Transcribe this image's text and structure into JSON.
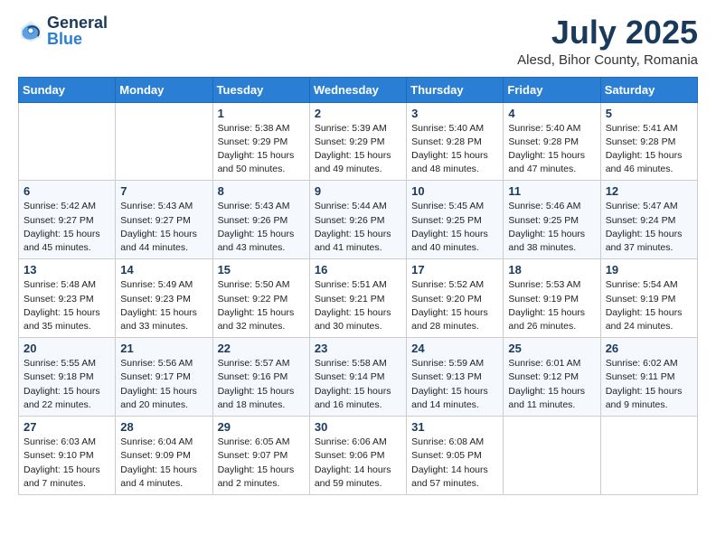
{
  "logo": {
    "general": "General",
    "blue": "Blue"
  },
  "header": {
    "month_year": "July 2025",
    "location": "Alesd, Bihor County, Romania"
  },
  "days_of_week": [
    "Sunday",
    "Monday",
    "Tuesday",
    "Wednesday",
    "Thursday",
    "Friday",
    "Saturday"
  ],
  "weeks": [
    [
      {
        "day": "",
        "info": ""
      },
      {
        "day": "",
        "info": ""
      },
      {
        "day": "1",
        "info": "Sunrise: 5:38 AM\nSunset: 9:29 PM\nDaylight: 15 hours\nand 50 minutes."
      },
      {
        "day": "2",
        "info": "Sunrise: 5:39 AM\nSunset: 9:29 PM\nDaylight: 15 hours\nand 49 minutes."
      },
      {
        "day": "3",
        "info": "Sunrise: 5:40 AM\nSunset: 9:28 PM\nDaylight: 15 hours\nand 48 minutes."
      },
      {
        "day": "4",
        "info": "Sunrise: 5:40 AM\nSunset: 9:28 PM\nDaylight: 15 hours\nand 47 minutes."
      },
      {
        "day": "5",
        "info": "Sunrise: 5:41 AM\nSunset: 9:28 PM\nDaylight: 15 hours\nand 46 minutes."
      }
    ],
    [
      {
        "day": "6",
        "info": "Sunrise: 5:42 AM\nSunset: 9:27 PM\nDaylight: 15 hours\nand 45 minutes."
      },
      {
        "day": "7",
        "info": "Sunrise: 5:43 AM\nSunset: 9:27 PM\nDaylight: 15 hours\nand 44 minutes."
      },
      {
        "day": "8",
        "info": "Sunrise: 5:43 AM\nSunset: 9:26 PM\nDaylight: 15 hours\nand 43 minutes."
      },
      {
        "day": "9",
        "info": "Sunrise: 5:44 AM\nSunset: 9:26 PM\nDaylight: 15 hours\nand 41 minutes."
      },
      {
        "day": "10",
        "info": "Sunrise: 5:45 AM\nSunset: 9:25 PM\nDaylight: 15 hours\nand 40 minutes."
      },
      {
        "day": "11",
        "info": "Sunrise: 5:46 AM\nSunset: 9:25 PM\nDaylight: 15 hours\nand 38 minutes."
      },
      {
        "day": "12",
        "info": "Sunrise: 5:47 AM\nSunset: 9:24 PM\nDaylight: 15 hours\nand 37 minutes."
      }
    ],
    [
      {
        "day": "13",
        "info": "Sunrise: 5:48 AM\nSunset: 9:23 PM\nDaylight: 15 hours\nand 35 minutes."
      },
      {
        "day": "14",
        "info": "Sunrise: 5:49 AM\nSunset: 9:23 PM\nDaylight: 15 hours\nand 33 minutes."
      },
      {
        "day": "15",
        "info": "Sunrise: 5:50 AM\nSunset: 9:22 PM\nDaylight: 15 hours\nand 32 minutes."
      },
      {
        "day": "16",
        "info": "Sunrise: 5:51 AM\nSunset: 9:21 PM\nDaylight: 15 hours\nand 30 minutes."
      },
      {
        "day": "17",
        "info": "Sunrise: 5:52 AM\nSunset: 9:20 PM\nDaylight: 15 hours\nand 28 minutes."
      },
      {
        "day": "18",
        "info": "Sunrise: 5:53 AM\nSunset: 9:19 PM\nDaylight: 15 hours\nand 26 minutes."
      },
      {
        "day": "19",
        "info": "Sunrise: 5:54 AM\nSunset: 9:19 PM\nDaylight: 15 hours\nand 24 minutes."
      }
    ],
    [
      {
        "day": "20",
        "info": "Sunrise: 5:55 AM\nSunset: 9:18 PM\nDaylight: 15 hours\nand 22 minutes."
      },
      {
        "day": "21",
        "info": "Sunrise: 5:56 AM\nSunset: 9:17 PM\nDaylight: 15 hours\nand 20 minutes."
      },
      {
        "day": "22",
        "info": "Sunrise: 5:57 AM\nSunset: 9:16 PM\nDaylight: 15 hours\nand 18 minutes."
      },
      {
        "day": "23",
        "info": "Sunrise: 5:58 AM\nSunset: 9:14 PM\nDaylight: 15 hours\nand 16 minutes."
      },
      {
        "day": "24",
        "info": "Sunrise: 5:59 AM\nSunset: 9:13 PM\nDaylight: 15 hours\nand 14 minutes."
      },
      {
        "day": "25",
        "info": "Sunrise: 6:01 AM\nSunset: 9:12 PM\nDaylight: 15 hours\nand 11 minutes."
      },
      {
        "day": "26",
        "info": "Sunrise: 6:02 AM\nSunset: 9:11 PM\nDaylight: 15 hours\nand 9 minutes."
      }
    ],
    [
      {
        "day": "27",
        "info": "Sunrise: 6:03 AM\nSunset: 9:10 PM\nDaylight: 15 hours\nand 7 minutes."
      },
      {
        "day": "28",
        "info": "Sunrise: 6:04 AM\nSunset: 9:09 PM\nDaylight: 15 hours\nand 4 minutes."
      },
      {
        "day": "29",
        "info": "Sunrise: 6:05 AM\nSunset: 9:07 PM\nDaylight: 15 hours\nand 2 minutes."
      },
      {
        "day": "30",
        "info": "Sunrise: 6:06 AM\nSunset: 9:06 PM\nDaylight: 14 hours\nand 59 minutes."
      },
      {
        "day": "31",
        "info": "Sunrise: 6:08 AM\nSunset: 9:05 PM\nDaylight: 14 hours\nand 57 minutes."
      },
      {
        "day": "",
        "info": ""
      },
      {
        "day": "",
        "info": ""
      }
    ]
  ]
}
